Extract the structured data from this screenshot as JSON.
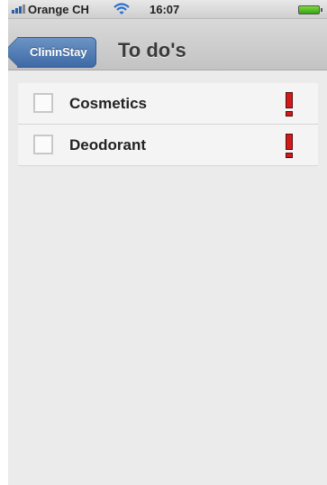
{
  "status_bar": {
    "carrier": "Orange CH",
    "time": "16:07",
    "battery_level": 1.0
  },
  "nav": {
    "back_label": "ClininStay",
    "title": "To do's"
  },
  "todos": [
    {
      "label": "Cosmetics",
      "checked": false,
      "priority": "high",
      "priority_icon": "exclamation-icon",
      "priority_color": "#d21a1a"
    },
    {
      "label": "Deodorant",
      "checked": false,
      "priority": "high",
      "priority_icon": "exclamation-icon",
      "priority_color": "#d21a1a"
    }
  ],
  "colors": {
    "back_button": "#4a76b0",
    "nav_bar": "#cfcfcf",
    "background": "#ebebeb"
  }
}
